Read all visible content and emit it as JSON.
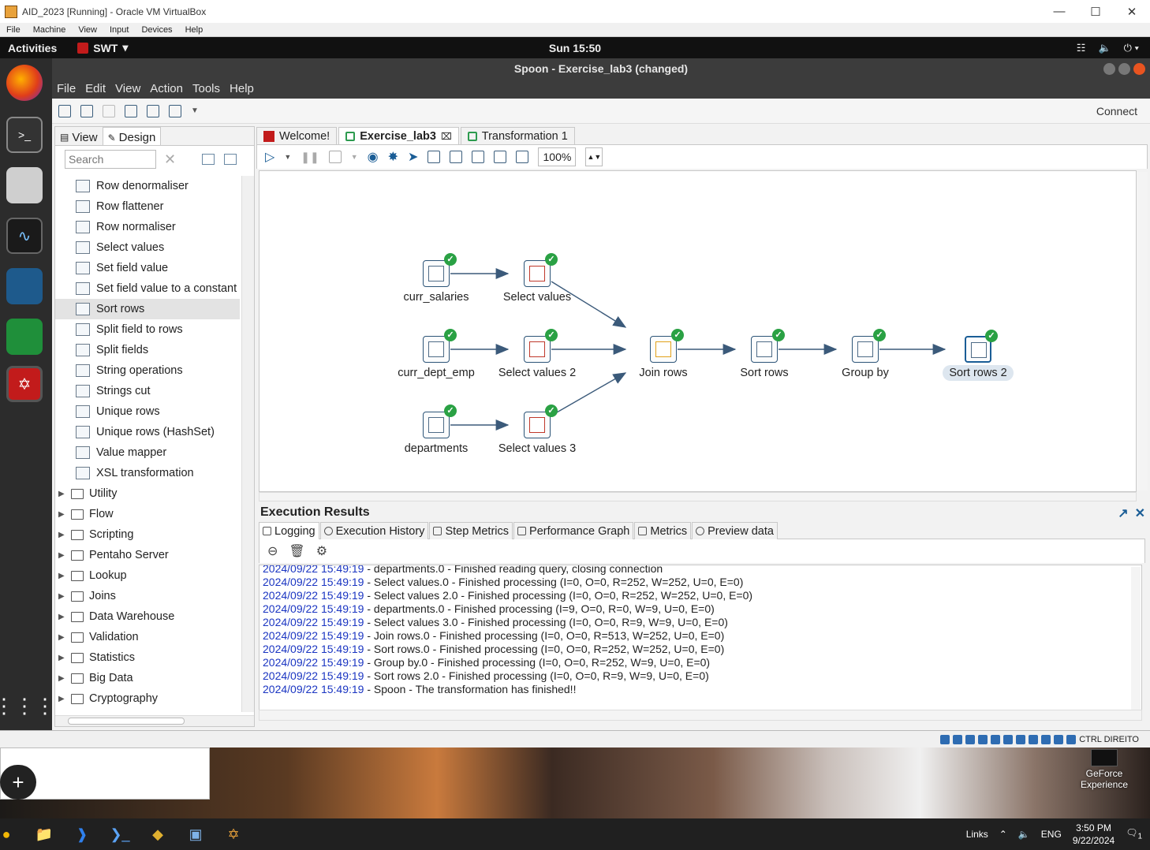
{
  "vbox": {
    "title": "AID_2023 [Running] - Oracle VM VirtualBox",
    "menu": [
      "File",
      "Machine",
      "View",
      "Input",
      "Devices",
      "Help"
    ],
    "status_key": "CTRL DIREITO"
  },
  "gnome": {
    "activities": "Activities",
    "app_name": "SWT",
    "clock": "Sun 15:50"
  },
  "spoon": {
    "title": "Spoon - Exercise_lab3 (changed)",
    "menu": [
      "File",
      "Edit",
      "View",
      "Action",
      "Tools",
      "Help"
    ],
    "connect": "Connect"
  },
  "left_panel": {
    "tabs": [
      "View",
      "Design"
    ],
    "search_placeholder": "Search",
    "steps": [
      "Row denormaliser",
      "Row flattener",
      "Row normaliser",
      "Select values",
      "Set field value",
      "Set field value to a constant",
      "Sort rows",
      "Split field to rows",
      "Split fields",
      "String operations",
      "Strings cut",
      "Unique rows",
      "Unique rows (HashSet)",
      "Value mapper",
      "XSL transformation"
    ],
    "selected_step": "Sort rows",
    "folders": [
      "Utility",
      "Flow",
      "Scripting",
      "Pentaho Server",
      "Lookup",
      "Joins",
      "Data Warehouse",
      "Validation",
      "Statistics",
      "Big Data",
      "Cryptography"
    ]
  },
  "editor": {
    "tabs": [
      "Welcome!",
      "Exercise_lab3",
      "Transformation 1"
    ],
    "active_tab": "Exercise_lab3",
    "zoom": "100%"
  },
  "canvas": {
    "steps": [
      "curr_salaries",
      "Select values",
      "curr_dept_emp",
      "Select values 2",
      "departments",
      "Select values 3",
      "Join rows",
      "Sort rows",
      "Group by",
      "Sort rows 2"
    ],
    "selected": "Sort rows 2"
  },
  "results": {
    "title": "Execution Results",
    "tabs": [
      "Logging",
      "Execution History",
      "Step Metrics",
      "Performance Graph",
      "Metrics",
      "Preview data"
    ],
    "active_tab": "Logging",
    "log": [
      {
        "ts": "2024/09/22 15:49:19",
        "msg": " - departments.0 - Finished reading query, closing connection"
      },
      {
        "ts": "2024/09/22 15:49:19",
        "msg": " - Select values.0 - Finished processing (I=0, O=0, R=252, W=252, U=0, E=0)"
      },
      {
        "ts": "2024/09/22 15:49:19",
        "msg": " - Select values 2.0 - Finished processing (I=0, O=0, R=252, W=252, U=0, E=0)"
      },
      {
        "ts": "2024/09/22 15:49:19",
        "msg": " - departments.0 - Finished processing (I=9, O=0, R=0, W=9, U=0, E=0)"
      },
      {
        "ts": "2024/09/22 15:49:19",
        "msg": " - Select values 3.0 - Finished processing (I=0, O=0, R=9, W=9, U=0, E=0)"
      },
      {
        "ts": "2024/09/22 15:49:19",
        "msg": " - Join rows.0 - Finished processing (I=0, O=0, R=513, W=252, U=0, E=0)"
      },
      {
        "ts": "2024/09/22 15:49:19",
        "msg": " - Sort rows.0 - Finished processing (I=0, O=0, R=252, W=252, U=0, E=0)"
      },
      {
        "ts": "2024/09/22 15:49:19",
        "msg": " - Group by.0 - Finished processing (I=0, O=0, R=252, W=9, U=0, E=0)"
      },
      {
        "ts": "2024/09/22 15:49:19",
        "msg": " - Sort rows 2.0 - Finished processing (I=0, O=0, R=9, W=9, U=0, E=0)"
      },
      {
        "ts": "2024/09/22 15:49:19",
        "msg": " - Spoon - The transformation has finished!!"
      }
    ]
  },
  "desktop": {
    "gfe_line1": "GeForce",
    "gfe_line2": "Experience"
  },
  "taskbar": {
    "links": "Links",
    "lang": "ENG",
    "time": "3:50 PM",
    "date": "9/22/2024",
    "notif": "1"
  },
  "colors": {
    "log_timestamp": "#1a35c2",
    "step_ok": "#2aa144",
    "hop": "#3b5a7a"
  }
}
